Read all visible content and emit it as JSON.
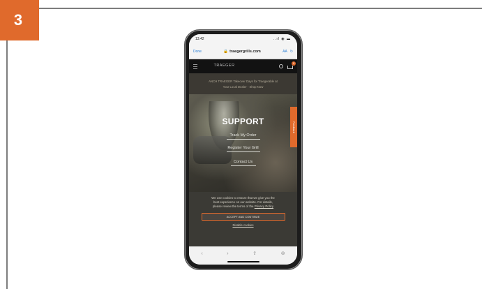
{
  "step": {
    "number": "3"
  },
  "phone": {
    "status_time": "13:42",
    "status_icons": "..ıl ◉ ▬",
    "browser": {
      "done_label": "Done",
      "url": "traegergrills.com",
      "aa_label": "AA",
      "reload_label": "↻"
    },
    "site": {
      "logo_text": "TRAEGER",
      "cart_count": "0",
      "promo_line1": "ANCH TRAEGER Takeover Days for Traegerable at",
      "promo_line2": "Your Local Dealer - Shop Now",
      "hero_title": "SUPPORT",
      "links": [
        "Track My Order",
        "Register Your Grill",
        "Contact Us"
      ],
      "feedback_tab": "Feedback",
      "cookie_text_1": "We use cookies to ensure that we give you the",
      "cookie_text_2": "best experience on our website. For details,",
      "cookie_text_3": "please review the terms of the",
      "privacy_link": "Privacy Policy",
      "accept_label": "ACCEPT AND CONTINUE",
      "disable_label": "Disable cookies"
    },
    "toolbar": {
      "back_label": "‹",
      "forward_label": "›",
      "share_label": "⇧",
      "safari_label": "⊚"
    }
  }
}
